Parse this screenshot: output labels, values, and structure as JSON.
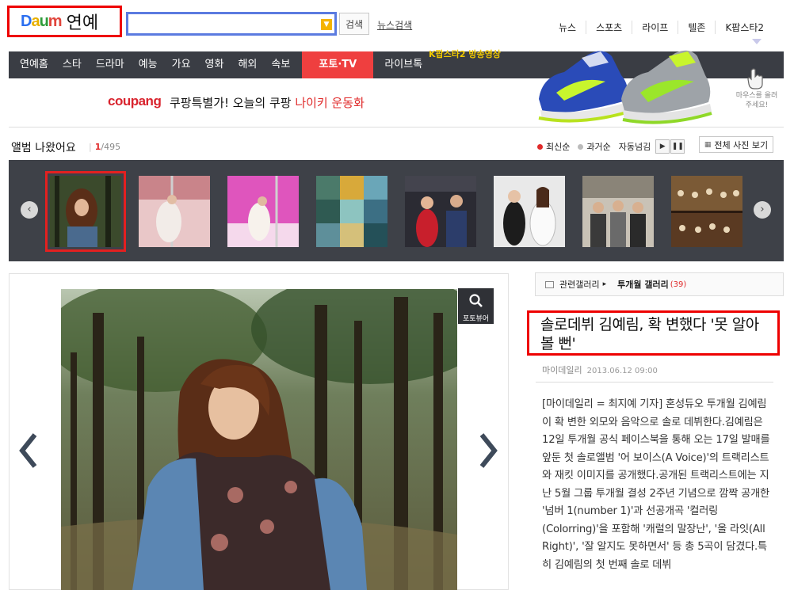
{
  "header": {
    "logo_brand_letters": [
      "D",
      "a",
      "u",
      "m"
    ],
    "logo_section": "연예",
    "search_placeholder": "",
    "search_button": "검색",
    "news_search": "뉴스검색",
    "topnav": [
      "뉴스",
      "스포츠",
      "라이프",
      "텔존",
      "K팝스타2"
    ]
  },
  "mainnav": {
    "items": [
      "연예홈",
      "스타",
      "드라마",
      "예능",
      "가요",
      "영화",
      "해외",
      "속보"
    ],
    "active": "포토·TV",
    "live": "라이브톡",
    "promo_text": "K팝스타2 방송영상"
  },
  "ad": {
    "brand": "coupang",
    "text_black": "쿠팡특별가! 오늘의 쿠팡 ",
    "text_red": "나이키 운동화",
    "hint": "마우스를 올려주세요!"
  },
  "album": {
    "title": "앨범 나왔어요",
    "current": "1",
    "total": "/495",
    "sort_latest": "최신순",
    "sort_past": "과거순",
    "autoplay": "자동넘김",
    "all_photos": "전체 사진 보기",
    "colors": {
      "latest_dot": "#e02a2a",
      "past_dot": "#bbbbbb"
    }
  },
  "thumbnails": [
    {
      "name": "thumb-1",
      "selected": true
    },
    {
      "name": "thumb-2",
      "selected": false
    },
    {
      "name": "thumb-3",
      "selected": false
    },
    {
      "name": "thumb-4",
      "selected": false
    },
    {
      "name": "thumb-5",
      "selected": false
    },
    {
      "name": "thumb-6",
      "selected": false
    },
    {
      "name": "thumb-7",
      "selected": false
    },
    {
      "name": "thumb-8",
      "selected": false
    }
  ],
  "viewer": {
    "label": "포토뷰어"
  },
  "related": {
    "label": "관련갤러리",
    "gallery": "투개월 갤러리",
    "count": "(39)"
  },
  "article": {
    "headline": "솔로데뷔 김예림, 확 변했다 '못 알아볼 뻔'",
    "source": "마이데일리",
    "date": "2013.06.12 09:00",
    "body": "[마이데일리 = 최지예 기자] 혼성듀오 투개월 김예림이 확 변한 외모와 음악으로 솔로 데뷔한다.김예림은 12일 투개월 공식 페이스북을 통해 오는 17일 발매를 앞둔 첫 솔로앨범 '어 보이스(A Voice)'의 트랙리스트와 재킷 이미지를 공개했다.공개된 트랙리스트에는 지난 5월 그룹 투개월 결성 2주년 기념으로 깜짝 공개한 '넘버 1(number 1)'과 선공개곡 '컬러링(Colorring)'을 포함해 '캐럴의 말장난', '올 라잇(All Right)', '잘 알지도 못하면서' 등 총 5곡이 담겼다.특히 김예림의 첫 번째 솔로 데뷔"
  }
}
